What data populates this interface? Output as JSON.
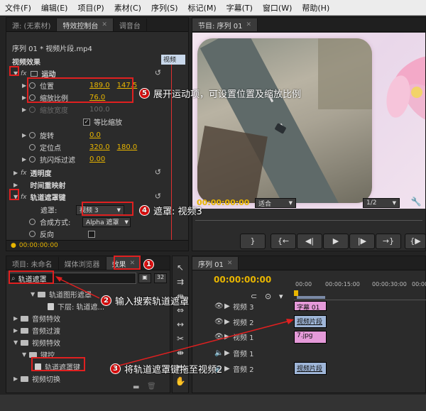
{
  "menu": [
    "文件(F)",
    "编辑(E)",
    "项目(P)",
    "素材(C)",
    "序列(S)",
    "标记(M)",
    "字幕(T)",
    "窗口(W)",
    "帮助(H)"
  ],
  "top_left_tabs": [
    "源: (无素材)",
    "特效控制台",
    "调音台"
  ],
  "effect_controls": {
    "clip_title": "序列 01 * 视频片段.mp4",
    "header": "视频效果",
    "motion": "运动",
    "position_label": "位置",
    "position_x": "189.0",
    "position_y": "147.5",
    "scale_label": "缩放比例",
    "scale_value": "76.0",
    "scale_width_label": "缩放宽度",
    "scale_width_value": "100.0",
    "uniform_scale": "等比缩放",
    "rotation_label": "旋转",
    "rotation_value": "0.0",
    "anchor_label": "定位点",
    "anchor_x": "320.0",
    "anchor_y": "180.0",
    "antiflicker_label": "抗闪烁过滤",
    "antiflicker_value": "0.00",
    "opacity": "透明度",
    "time_remap": "时间重映射",
    "track_matte": "轨道遮罩键",
    "matte_label": "遮罩:",
    "matte_value": "视频 3",
    "composite_label": "合成方式:",
    "composite_value": "Alpha 遮罩",
    "reverse_label": "反向",
    "timecode": "00:00:00:00",
    "mini_clip": "视频"
  },
  "program": {
    "tab": "节目: 序列 01",
    "timecode": "00:00:00:00",
    "fit": "适合",
    "resolution": "1/2"
  },
  "project_tabs": [
    "项目: 未命名",
    "媒体浏览器",
    "效果"
  ],
  "search_value": "轨道遮罩",
  "effects_tree": [
    {
      "label": "轨道图形遮罩",
      "level": 3
    },
    {
      "label": "下层: 轨道遮...",
      "level": 4
    },
    {
      "label": "音频特效",
      "level": 1
    },
    {
      "label": "音频过渡",
      "level": 1
    },
    {
      "label": "视频特效",
      "level": 1
    },
    {
      "label": "键控",
      "level": 2
    },
    {
      "label": "轨道遮罩键",
      "level": 3
    },
    {
      "label": "视频切换",
      "level": 1
    }
  ],
  "timeline": {
    "tab": "序列 01",
    "timecode": "00:00:00:00",
    "ruler": [
      "00:00",
      "00:00:15:00",
      "00:00:30:00",
      "00:00"
    ],
    "tracks": [
      "视频 3",
      "视频 2",
      "视频 1",
      "音频 1",
      "音频 2"
    ],
    "clip_v3": "字幕 01",
    "clip_v2": "视频片段",
    "clip_v1": "7.jpg",
    "clip_a2": "视频片段"
  },
  "callouts": {
    "c1": "1",
    "c2_num": "2",
    "c2": "输入搜索轨道遮罩",
    "c3_num": "3",
    "c3": "将轨道遮罩键拖至视频2",
    "c4_num": "4",
    "c4": "遮罩: 视频3",
    "c5_num": "5",
    "c5": "展开运动项，可设置位置及缩放比例"
  }
}
